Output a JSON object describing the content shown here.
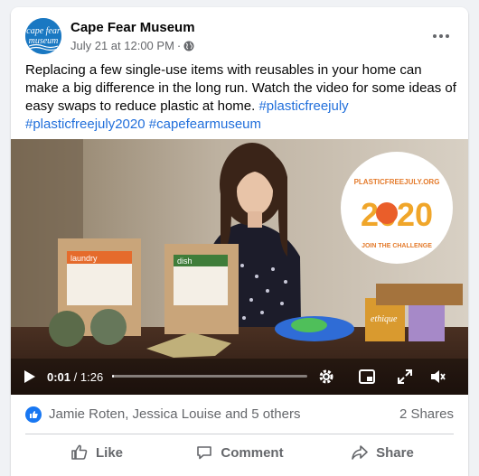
{
  "post": {
    "page_name": "Cape Fear Museum",
    "avatar_text_top": "cape fear",
    "avatar_text_bottom": "museum",
    "timestamp": "July 21 at 12:00 PM",
    "separator": "·",
    "privacy_icon": "globe-icon",
    "text_main": "Replacing a few single-use items with reusables in your home can make a big difference in the long run. Watch the video for some ideas of easy swaps to reduce plastic at home.",
    "hashtags": [
      "#plasticfreejuly",
      "#plasticfreejuly2020",
      "#capefearmuseum"
    ]
  },
  "video": {
    "current_time": "0:01",
    "duration": "/ 1:26",
    "progress_fraction": 0.01,
    "badge_line1": "PLASTICFREEJULY.ORG",
    "badge_year": "2020",
    "badge_line2": "JOIN THE CHALLENGE",
    "box1_label": "laundry",
    "box2_label": "dish",
    "product_label": "ethique"
  },
  "reactions": {
    "names": "Jamie Roten, Jessica Louise and 5 others",
    "shares": "2 Shares"
  },
  "actions": {
    "like": "Like",
    "comment": "Comment",
    "share": "Share"
  },
  "colors": {
    "link": "#216fdb",
    "brand_blue": "#1877f2",
    "muted": "#65676b"
  }
}
